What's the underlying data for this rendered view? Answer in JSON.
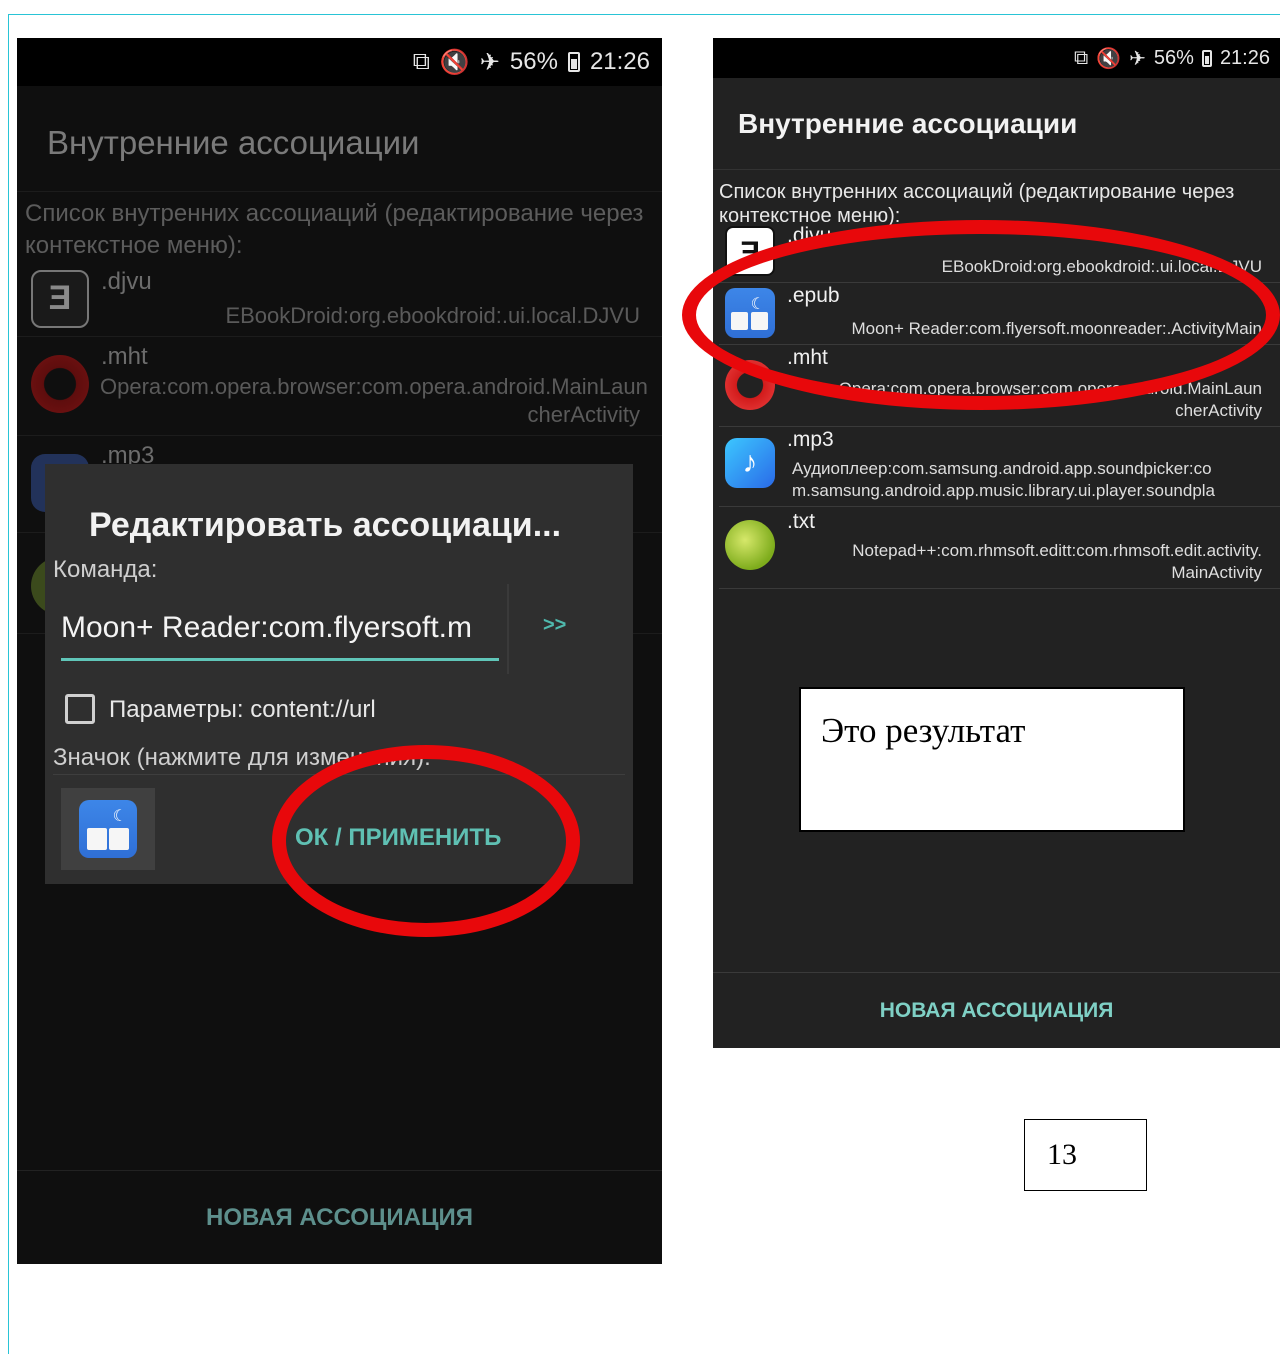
{
  "status_bar": {
    "battery": "56%",
    "time": "21:26"
  },
  "left_screen": {
    "title": "Внутренние ассоциации",
    "subtitle": "Список внутренних ассоциаций (редактирование через контекстное меню):",
    "rows": [
      {
        "ext": ".djvu",
        "pkg": "EBookDroid:org.ebookdroid:.ui.local.DJVU"
      },
      {
        "ext": ".mht",
        "pkg": "Opera:com.opera.browser:com.opera.android.MainLaun cherActivity"
      },
      {
        "ext": ".mp3",
        "pkg": ""
      }
    ],
    "dialog": {
      "title": "Редактировать ассоциаци...",
      "command_label": "Команда:",
      "command_value": "Moon+ Reader:com.flyersoft.m",
      "next_button": ">>",
      "params_label": "Параметры: content://url",
      "icon_label": "Значок (нажмите для изменения):",
      "ok_button": "ОК / ПРИМЕНИТЬ"
    },
    "new_association_button": "НОВАЯ АССОЦИАЦИЯ"
  },
  "right_screen": {
    "title": "Внутренние ассоциации",
    "subtitle": "Список внутренних ассоциаций (редактирование через контекстное меню):",
    "rows": [
      {
        "ext": ".djvu",
        "pkg": "EBookDroid:org.ebookdroid:.ui.local.DJVU"
      },
      {
        "ext": ".epub",
        "pkg": "Moon+ Reader:com.flyersoft.moonreader:.ActivityMain"
      },
      {
        "ext": ".mht",
        "pkg": "Opera:com.opera.browser:com.opera.android.MainLaun cherActivity"
      },
      {
        "ext": ".mp3",
        "pkg": "Аудиоплеер:com.samsung.android.app.soundpicker:co m.samsung.android.app.music.library.ui.player.soundpla"
      },
      {
        "ext": ".txt",
        "pkg": "Notepad++:com.rhmsoft.editt:com.rhmsoft.edit.activity. MainActivity"
      }
    ],
    "new_association_button": "НОВАЯ АССОЦИАЦИЯ"
  },
  "result_caption": "Это результат",
  "page_number": "13",
  "colors": {
    "highlight": "#e8080b",
    "accent": "#60c6b9",
    "page_border": "#29c4d6"
  }
}
